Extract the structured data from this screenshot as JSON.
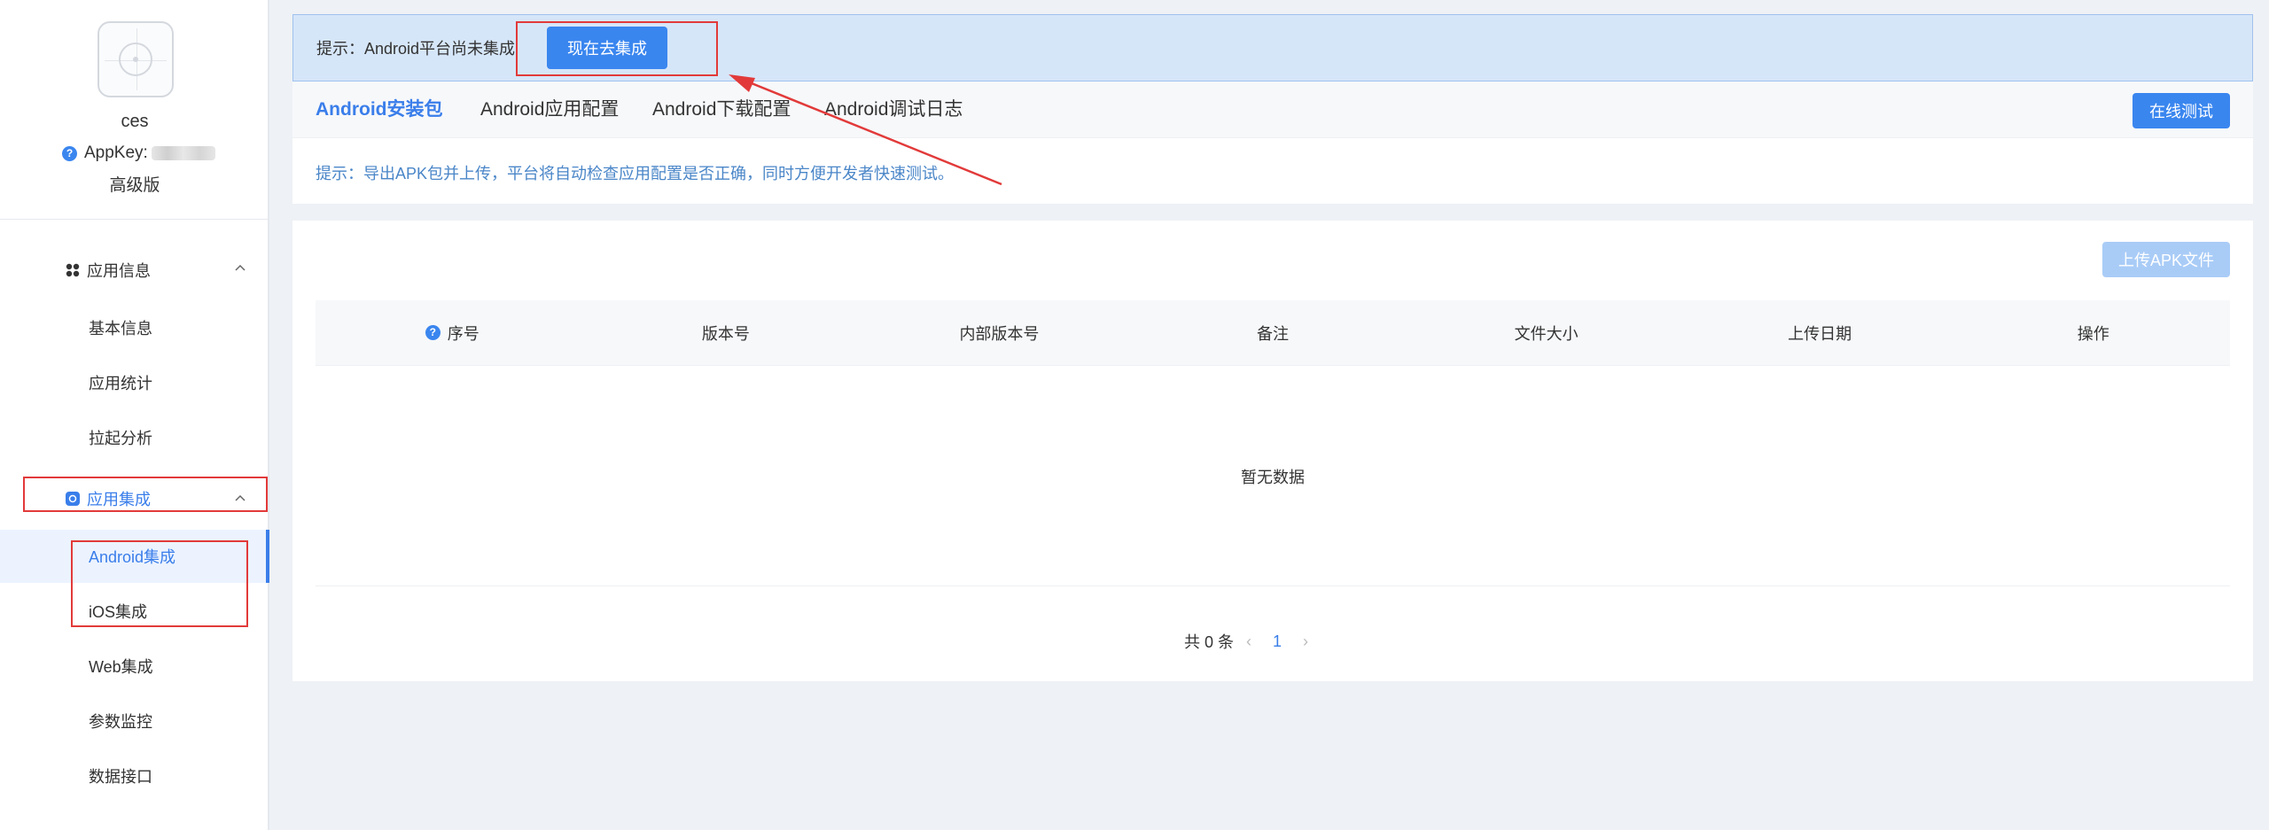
{
  "sidebar": {
    "app_name": "ces",
    "appkey_label": "AppKey:",
    "edition": "高级版",
    "groups": [
      {
        "label": "应用信息",
        "icon": "grid-icon"
      },
      {
        "label": "应用集成",
        "icon": "integration-icon"
      }
    ],
    "items": [
      {
        "label": "基本信息"
      },
      {
        "label": "应用统计"
      },
      {
        "label": "拉起分析"
      },
      {
        "label": "Android集成"
      },
      {
        "label": "iOS集成"
      },
      {
        "label": "Web集成"
      },
      {
        "label": "参数监控"
      },
      {
        "label": "数据接口"
      }
    ]
  },
  "notice": {
    "text": "提示：Android平台尚未集成",
    "button": "现在去集成"
  },
  "tabs": [
    {
      "label": "Android安装包",
      "active": true
    },
    {
      "label": "Android应用配置"
    },
    {
      "label": "Android下载配置"
    },
    {
      "label": "Android调试日志"
    }
  ],
  "online_test_button": "在线测试",
  "hint": "提示：导出APK包并上传，平台将自动检查应用配置是否正确，同时方便开发者快速测试。",
  "upload_button": "上传APK文件",
  "table": {
    "columns": [
      "序号",
      "版本号",
      "内部版本号",
      "备注",
      "文件大小",
      "上传日期",
      "操作"
    ],
    "empty_text": "暂无数据"
  },
  "pagination": {
    "total": "共 0 条",
    "current_page": "1"
  },
  "colors": {
    "primary": "#3a86ef",
    "annotation_red": "#e23a3a",
    "notice_bg": "#d6e6f9"
  }
}
